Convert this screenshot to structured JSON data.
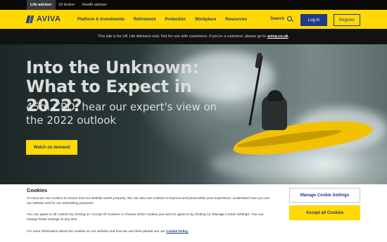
{
  "audience_tabs": [
    "Life adviser",
    "GI broker",
    "Health adviser"
  ],
  "logo": {
    "text": "AVIVA"
  },
  "nav": {
    "items": [
      "Platform & Investments",
      "Retirement",
      "Protection",
      "Workplace",
      "Resources"
    ],
    "search_label": "Search",
    "login_label": "Log in",
    "register_label": "Register"
  },
  "notice": {
    "text": "This site is for UK Life Advisers only. Not for use with customers. If you're a customer, please go to",
    "link": "aviva.co.uk",
    "suffix": "."
  },
  "hero": {
    "title_line1": "Into the Unknown:",
    "title_line2": "What to Expect in 2022?",
    "subtitle": "45m CPD: hear our expert's view on the 2022 outlook",
    "cta": "Watch on demand"
  },
  "cookies": {
    "title": "Cookies",
    "paragraph1": "At Aviva we use cookies to ensure that our website works properly. We can also use cookies to improve and personalise your experience, understand how you use our website and for our advertising purposes.",
    "paragraph2": "You can agree to all cookies by clicking on 'Accept All Cookies' or choose which cookies you want to agree to by clicking on 'Manage Cookie Settings'. You can change these settings at any time.",
    "paragraph3": "For more information about the cookies on our website and how we use them please see our",
    "policy_link": "Cookie Policy",
    "manage_label": "Manage Cookie Settings",
    "accept_label": "Accept all Cookies"
  },
  "colors": {
    "brand_yellow": "#ffd900",
    "brand_blue": "#1e3a8a"
  },
  "icons": {
    "search": "search-icon"
  }
}
